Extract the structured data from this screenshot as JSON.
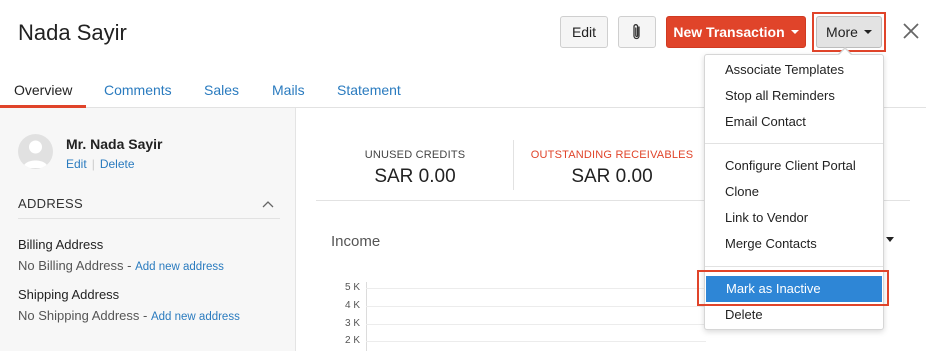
{
  "header": {
    "title": "Nada Sayir",
    "edit_label": "Edit",
    "new_transaction_label": "New Transaction",
    "more_label": "More"
  },
  "tabs": [
    {
      "label": "Overview",
      "active": true
    },
    {
      "label": "Comments"
    },
    {
      "label": "Sales"
    },
    {
      "label": "Mails"
    },
    {
      "label": "Statement"
    }
  ],
  "contact": {
    "name": "Mr. Nada Sayir",
    "edit_link": "Edit",
    "delete_link": "Delete"
  },
  "address": {
    "section_title": "ADDRESS",
    "billing_label": "Billing Address",
    "billing_value": "No Billing Address - ",
    "billing_link": "Add new address",
    "shipping_label": "Shipping Address",
    "shipping_value": "No Shipping Address - ",
    "shipping_link": "Add new address"
  },
  "summary": {
    "unused_credits_label": "UNUSED CREDITS",
    "unused_credits_value": "SAR 0.00",
    "outstanding_label": "OUTSTANDING RECEIVABLES",
    "outstanding_value": "SAR 0.00"
  },
  "income": {
    "title": "Income",
    "y_ticks": [
      "5 K",
      "4 K",
      "3 K",
      "2 K"
    ]
  },
  "menu": {
    "items": [
      "Associate Templates",
      "Stop all Reminders",
      "Email Contact",
      "Configure Client Portal",
      "Clone",
      "Link to Vendor",
      "Merge Contacts",
      "Mark as Inactive",
      "Delete"
    ],
    "selected": "Mark as Inactive"
  },
  "colors": {
    "accent": "#e0442a",
    "link": "#2a7bbf",
    "selection": "#2e86d6"
  },
  "icons": {
    "attach": "paperclip-icon",
    "close": "close-icon",
    "collapse": "chevron-up-icon",
    "avatar": "user-avatar-icon"
  }
}
